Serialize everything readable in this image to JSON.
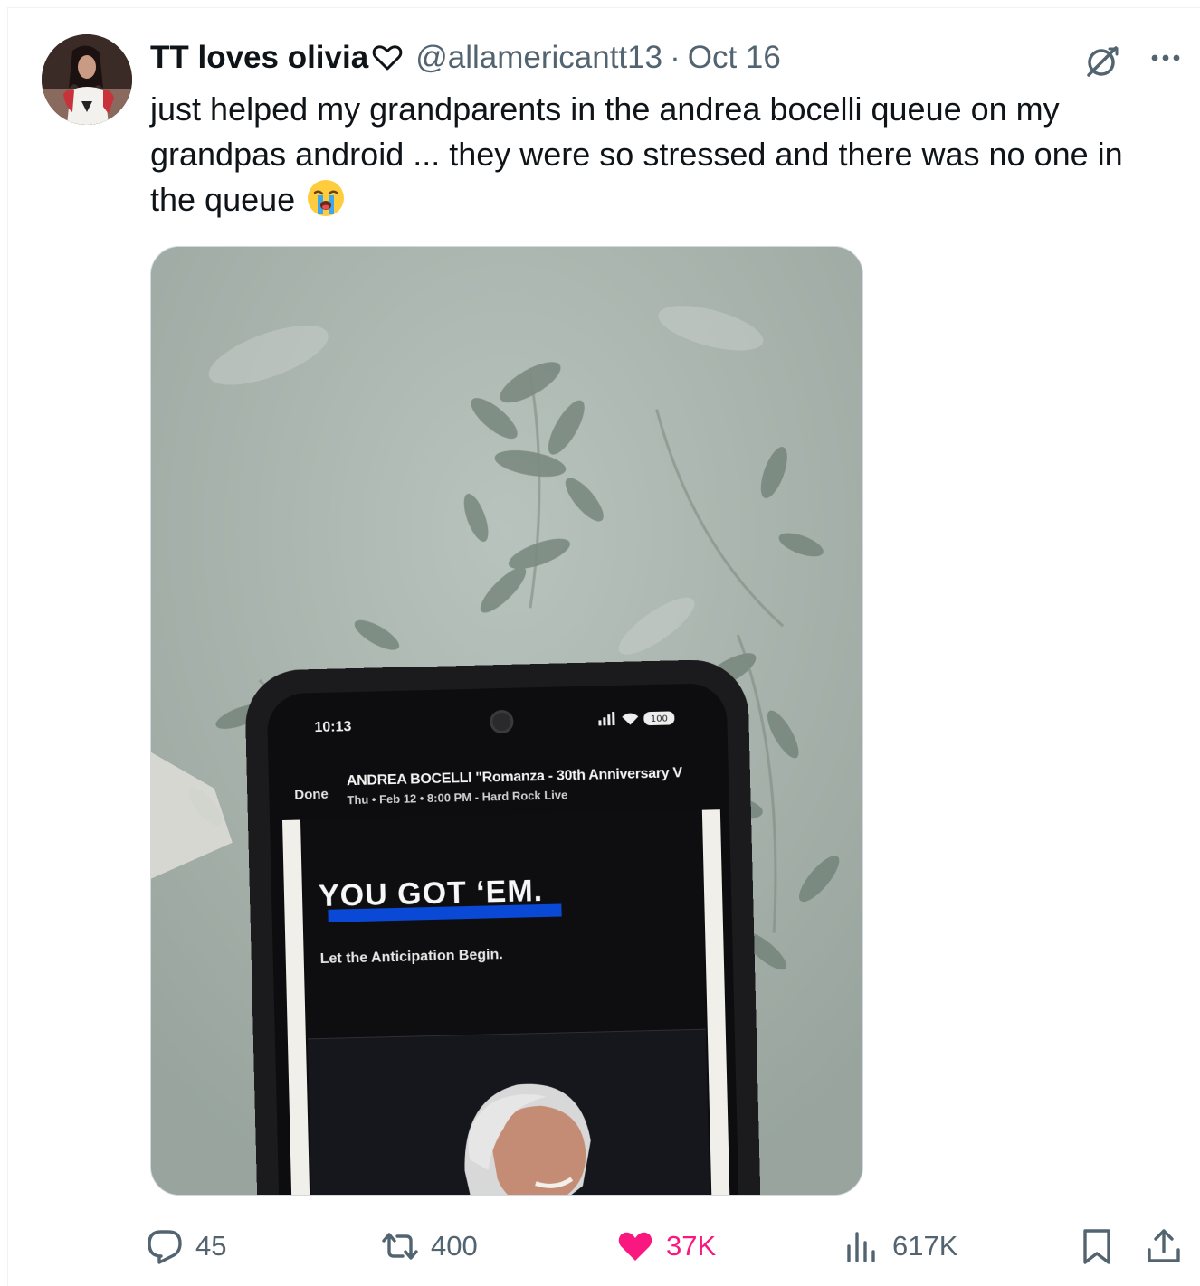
{
  "tweet": {
    "display_name": "TT loves olivia",
    "name_icon": "heart-outline-icon",
    "handle": "@allamericantt13",
    "separator": "·",
    "date": "Oct 16",
    "text": "just helped my grandparents in the andrea bocelli queue on my\ngrandpas android ... they were so stressed and there was no one in\nthe queue ",
    "emoji": "loudly-crying-face",
    "header_icons": [
      "grok-icon",
      "more-icon"
    ]
  },
  "media": {
    "phone": {
      "status_time": "10:13",
      "battery": "100",
      "done_label": "Done",
      "event_title": "ANDREA BOCELLI \"Romanza - 30th Anniversary V",
      "event_subtitle": "Thu • Feb 12 • 8:00 PM - Hard Rock Live",
      "headline": "YOU GOT ‘EM.",
      "subline": "Let the Anticipation Begin."
    }
  },
  "actions": {
    "replies": "45",
    "reposts": "400",
    "likes": "37K",
    "views": "617K",
    "icons": [
      "reply-icon",
      "repost-icon",
      "heart-filled-icon",
      "views-icon",
      "bookmark-icon",
      "share-icon"
    ]
  },
  "colors": {
    "text_primary": "#0f1419",
    "text_secondary": "#536471",
    "like_pink": "#f91880",
    "accent_blue": "#0a48d6"
  }
}
